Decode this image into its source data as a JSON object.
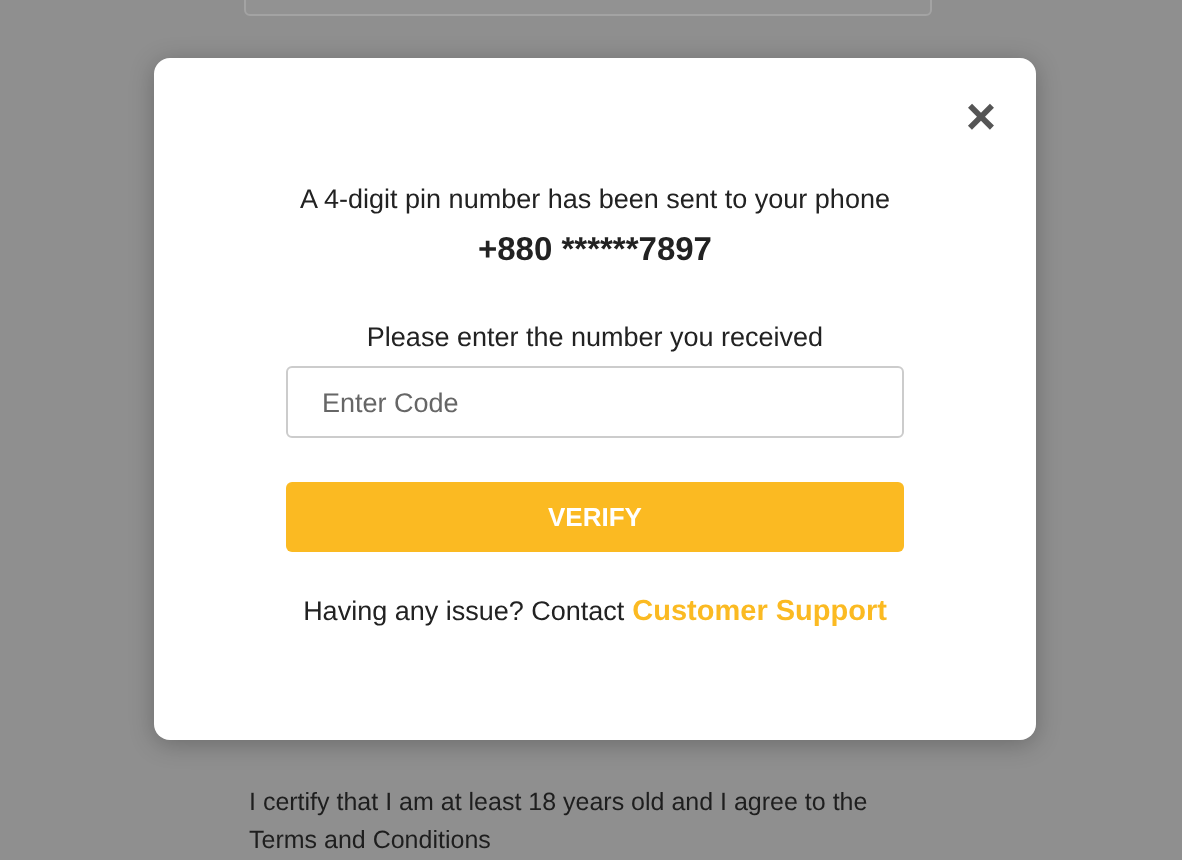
{
  "background": {
    "agreement": "I certify that I am at least 18 years old and I agree to the Terms and Conditions"
  },
  "modal": {
    "close": "×",
    "message": "A 4-digit pin number has been sent to your phone",
    "phone": "+880 ******7897",
    "prompt": "Please enter the number you received",
    "code_field": {
      "placeholder": "Enter Code"
    },
    "verify_button": "VERIFY",
    "support_text": "Having any issue? Contact",
    "support_link": "Customer Support"
  }
}
